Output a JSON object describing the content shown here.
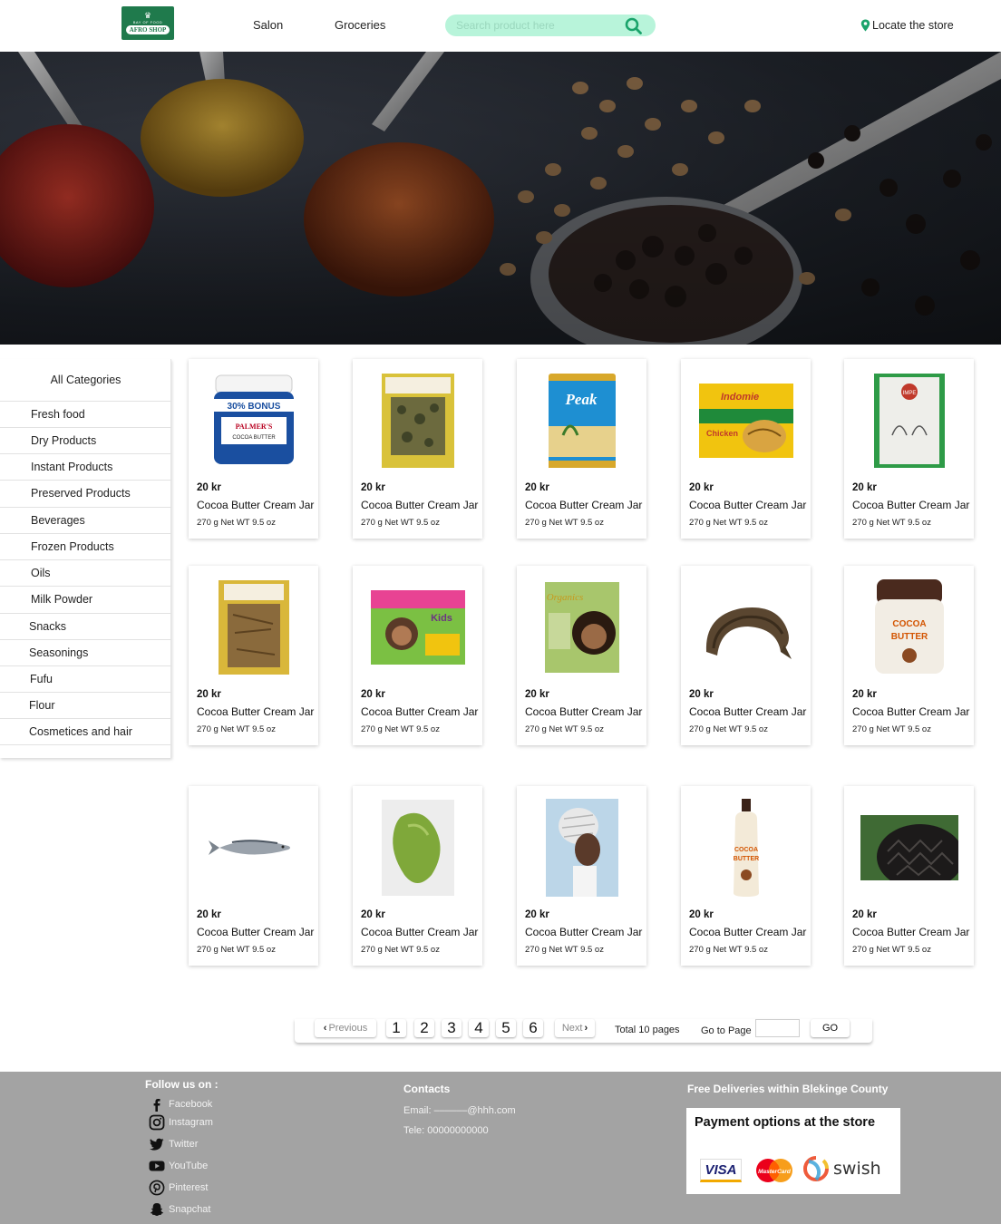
{
  "header": {
    "logo_top": "BAY OF FOOD",
    "logo_text": "AFRO SHOP",
    "nav": [
      "Salon",
      "Groceries"
    ],
    "search_placeholder": "Search product here",
    "locate_label": "Locate the store",
    "accent_color": "#b8f4da",
    "icons": {
      "search": "search-icon",
      "locate": "map-pin-icon"
    }
  },
  "sidebar": {
    "title": "All Categories",
    "categories": [
      "Fresh food",
      "Dry Products",
      "Instant Products",
      "Preserved Products",
      "Beverages",
      "Frozen Products",
      "Oils",
      "Milk Powder",
      "Snacks",
      "Seasonings",
      "Fufu",
      "Flour",
      "Cosmetices and hair"
    ]
  },
  "products": [
    {
      "price": "20 kr",
      "name": "Cocoa Butter Cream Jar",
      "desc": "270 g Net WT 9.5 oz",
      "img": "cocoa-butter-jar-image"
    },
    {
      "price": "20 kr",
      "name": "Cocoa Butter Cream Jar",
      "desc": "270 g Net WT 9.5 oz",
      "img": "dried-leaves-bag-image"
    },
    {
      "price": "20 kr",
      "name": "Cocoa Butter Cream Jar",
      "desc": "270 g Net WT 9.5 oz",
      "img": "milk-powder-tin-image"
    },
    {
      "price": "20 kr",
      "name": "Cocoa Butter Cream Jar",
      "desc": "270 g Net WT 9.5 oz",
      "img": "instant-noodles-pack-image"
    },
    {
      "price": "20 kr",
      "name": "Cocoa Butter Cream Jar",
      "desc": "270 g Net WT 9.5 oz",
      "img": "flour-bag-image"
    },
    {
      "price": "20 kr",
      "name": "Cocoa Butter Cream Jar",
      "desc": "270 g Net WT 9.5 oz",
      "img": "dried-fish-bag-image"
    },
    {
      "price": "20 kr",
      "name": "Cocoa Butter Cream Jar",
      "desc": "270 g Net WT 9.5 oz",
      "img": "kids-relaxer-box-image"
    },
    {
      "price": "20 kr",
      "name": "Cocoa Butter Cream Jar",
      "desc": "270 g Net WT 9.5 oz",
      "img": "olive-oil-relaxer-box-image"
    },
    {
      "price": "20 kr",
      "name": "Cocoa Butter Cream Jar",
      "desc": "270 g Net WT 9.5 oz",
      "img": "smoked-fish-image"
    },
    {
      "price": "20 kr",
      "name": "Cocoa Butter Cream Jar",
      "desc": "270 g Net WT 9.5 oz",
      "img": "cocoa-butter-tub-image"
    },
    {
      "price": "20 kr",
      "name": "Cocoa Butter Cream Jar",
      "desc": "270 g Net WT 9.5 oz",
      "img": "mackerel-fish-image"
    },
    {
      "price": "20 kr",
      "name": "Cocoa Butter Cream Jar",
      "desc": "270 g Net WT 9.5 oz",
      "img": "green-papaya-image"
    },
    {
      "price": "20 kr",
      "name": "Cocoa Butter Cream Jar",
      "desc": "270 g Net WT 9.5 oz",
      "img": "braided-hair-model-image"
    },
    {
      "price": "20 kr",
      "name": "Cocoa Butter Cream Jar",
      "desc": "270 g Net WT 9.5 oz",
      "img": "cocoa-butter-lotion-bottle-image"
    },
    {
      "price": "20 kr",
      "name": "Cocoa Butter Cream Jar",
      "desc": "270 g Net WT 9.5 oz",
      "img": "cornrow-braids-image"
    }
  ],
  "pagination": {
    "previous": "Previous",
    "pages": [
      "1",
      "2",
      "3",
      "4",
      "5",
      "6"
    ],
    "next": "Next",
    "total": "Total 10 pages",
    "goto_label": "Go to Page",
    "go_button": "GO"
  },
  "footer": {
    "follow_title": "Follow us on :",
    "social": [
      "Facebook",
      "Instagram",
      "Twitter",
      "YouTube",
      "Pinterest",
      "Snapchat"
    ],
    "contacts_title": "Contacts",
    "email": "Email: ––––––@hhh.com",
    "phone": "Tele: 00000000000",
    "delivery": "Free Deliveries within Blekinge County",
    "payment_title": "Payment options at the store",
    "payment_methods": [
      "VISA",
      "MasterCard",
      "swish"
    ],
    "background_color": "#a3a3a3"
  }
}
